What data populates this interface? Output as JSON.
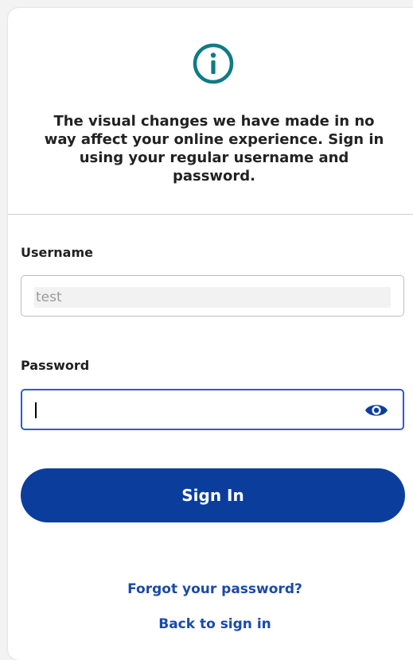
{
  "notice": {
    "message": "The visual changes we have made in no way affect your online experience. Sign in using your regular username and password."
  },
  "form": {
    "username_label": "Username",
    "username_value": "test",
    "password_label": "Password",
    "password_value": "",
    "sign_in_label": "Sign In"
  },
  "links": {
    "forgot_password": "Forgot your password?",
    "back_to_sign_in": "Back to sign in"
  },
  "icons": {
    "info": "info-circle-icon",
    "show_password": "eye-icon"
  },
  "colors": {
    "accent_teal": "#0e7b87",
    "button_blue": "#0b3e9c",
    "link_blue": "#1a4aa8",
    "focus_border": "#2f59d6"
  }
}
